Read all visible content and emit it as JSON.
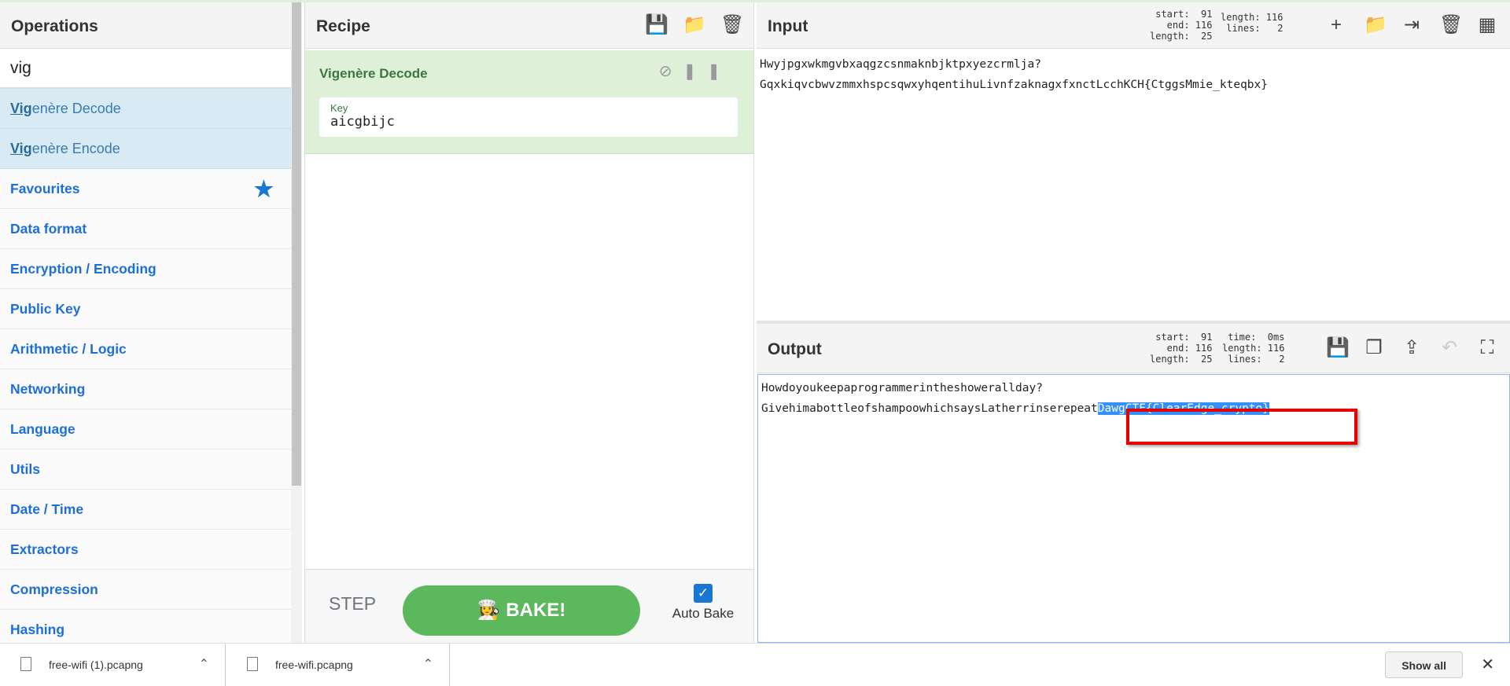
{
  "operations": {
    "title": "Operations",
    "search_value": "vig",
    "results": [
      {
        "match": "Vig",
        "rest": "enère Decode"
      },
      {
        "match": "Vig",
        "rest": "enère Encode"
      }
    ],
    "categories": [
      "Favourites",
      "Data format",
      "Encryption / Encoding",
      "Public Key",
      "Arithmetic / Logic",
      "Networking",
      "Language",
      "Utils",
      "Date / Time",
      "Extractors",
      "Compression",
      "Hashing"
    ]
  },
  "recipe": {
    "title": "Recipe",
    "icons": [
      "save-icon",
      "folder-icon",
      "trash-icon"
    ],
    "operation": {
      "name": "Vigenère Decode",
      "key_label": "Key",
      "key_value": "aicgbijc"
    },
    "step_label": "STEP",
    "bake_label": "BAKE!",
    "auto_bake_label": "Auto Bake",
    "auto_bake_checked": true
  },
  "input": {
    "title": "Input",
    "stats_left": "start:  91\n  end: 116\nlength:  25",
    "stats_right": "length: 116\n lines:   2",
    "lines": [
      "Hwyjpgxwkmgvbxaqgzcsnmaknbjktpxyezcrmlja?",
      "GqxkiqvcbwvzmmxhspcsqwxyhqentihuLivnfzaknagxfxnctLcchKCH{CtggsMmie_kteqbx}"
    ]
  },
  "output": {
    "title": "Output",
    "stats_left": "start:  91\n  end: 116\nlength:  25",
    "stats_right": "time:  0ms\nlength: 116\n lines:   2",
    "line1": "Howdoyoukeepaprogrammerintheshowerallday?",
    "line2_plain": "GivehimabottleofshampoowhichsaysLatherrinserepeat",
    "line2_selected": "DawgCTF{ClearEdge_crypto}"
  },
  "downloads": {
    "items": [
      "free-wifi (1).pcapng",
      "free-wifi.pcapng"
    ],
    "show_all": "Show all"
  },
  "colors": {
    "accent": "#1976d2",
    "bake": "#5cb85c",
    "recipe_card": "#dff0d8",
    "highlight_box": "#e60000"
  }
}
